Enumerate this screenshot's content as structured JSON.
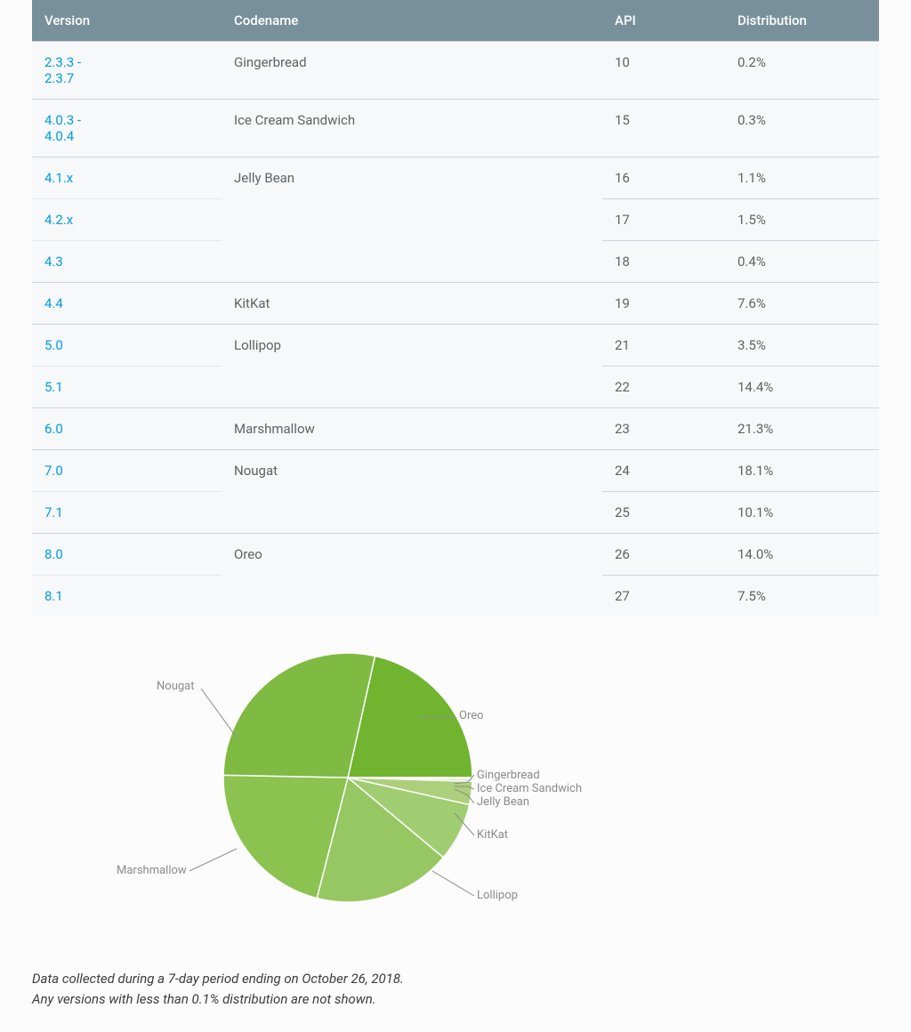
{
  "table": {
    "headers": {
      "version": "Version",
      "codename": "Codename",
      "api": "API",
      "dist": "Distribution"
    },
    "rows": [
      {
        "version": "2.3.3 -\n2.3.7",
        "codename": "Gingerbread",
        "api": "10",
        "dist": "0.2%",
        "group_start": true
      },
      {
        "version": "4.0.3 -\n4.0.4",
        "codename": "Ice Cream Sandwich",
        "api": "15",
        "dist": "0.3%",
        "group_start": true
      },
      {
        "version": "4.1.x",
        "codename": "Jelly Bean",
        "api": "16",
        "dist": "1.1%",
        "group_start": true
      },
      {
        "version": "4.2.x",
        "codename": "",
        "api": "17",
        "dist": "1.5%",
        "group_start": false
      },
      {
        "version": "4.3",
        "codename": "",
        "api": "18",
        "dist": "0.4%",
        "group_start": false
      },
      {
        "version": "4.4",
        "codename": "KitKat",
        "api": "19",
        "dist": "7.6%",
        "group_start": true
      },
      {
        "version": "5.0",
        "codename": "Lollipop",
        "api": "21",
        "dist": "3.5%",
        "group_start": true
      },
      {
        "version": "5.1",
        "codename": "",
        "api": "22",
        "dist": "14.4%",
        "group_start": false
      },
      {
        "version": "6.0",
        "codename": "Marshmallow",
        "api": "23",
        "dist": "21.3%",
        "group_start": true
      },
      {
        "version": "7.0",
        "codename": "Nougat",
        "api": "24",
        "dist": "18.1%",
        "group_start": true
      },
      {
        "version": "7.1",
        "codename": "",
        "api": "25",
        "dist": "10.1%",
        "group_start": false
      },
      {
        "version": "8.0",
        "codename": "Oreo",
        "api": "26",
        "dist": "14.0%",
        "group_start": true
      },
      {
        "version": "8.1",
        "codename": "",
        "api": "27",
        "dist": "7.5%",
        "group_start": false
      }
    ]
  },
  "chart_data": {
    "type": "pie",
    "title": "",
    "series": [
      {
        "name": "Oreo",
        "value": 21.5,
        "color": "#71b430"
      },
      {
        "name": "Gingerbread",
        "value": 0.2,
        "color": "#bede9c"
      },
      {
        "name": "Ice Cream Sandwich",
        "value": 0.3,
        "color": "#b5da90"
      },
      {
        "name": "Jelly Bean",
        "value": 3.0,
        "color": "#accf7c"
      },
      {
        "name": "KitKat",
        "value": 7.6,
        "color": "#a1cd72"
      },
      {
        "name": "Lollipop",
        "value": 17.9,
        "color": "#96c762"
      },
      {
        "name": "Marshmallow",
        "value": 21.3,
        "color": "#8bc250"
      },
      {
        "name": "Nougat",
        "value": 28.2,
        "color": "#7fba42"
      }
    ],
    "start_angle_deg": -77.4
  },
  "pie_labels": {
    "oreo": "Oreo",
    "gingerbread": "Gingerbread",
    "ics": "Ice Cream Sandwich",
    "jelly": "Jelly Bean",
    "kitkat": "KitKat",
    "lollipop": "Lollipop",
    "marsh": "Marshmallow",
    "nougat": "Nougat"
  },
  "notes": {
    "line1": "Data collected during a 7-day period ending on October 26, 2018.",
    "line2": "Any versions with less than 0.1% distribution are not shown."
  }
}
